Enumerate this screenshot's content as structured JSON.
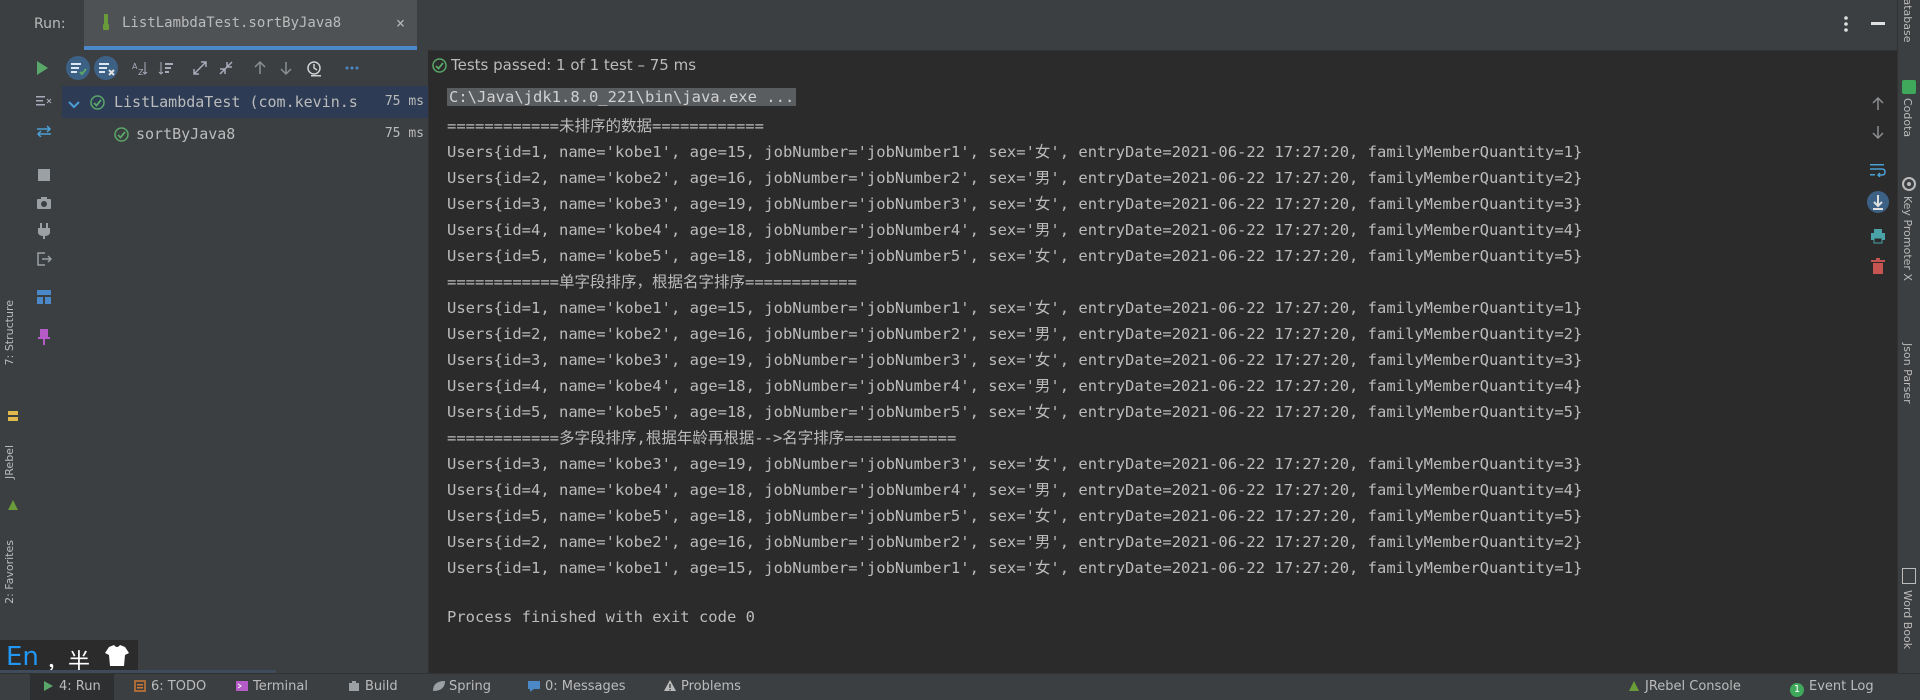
{
  "header": {
    "run_label": "Run:",
    "tab_title": "ListLambdaTest.sortByJava8",
    "close_glyph": "×"
  },
  "toolbar": {
    "status_text": "Tests passed: 1 of 1 test – 75 ms",
    "status_color": "#59a869"
  },
  "test_tree": {
    "root": {
      "name": "ListLambdaTest (com.kevin.s",
      "time": "75 ms"
    },
    "child": {
      "name": "sortByJava8",
      "time": "75 ms"
    }
  },
  "console": {
    "lines": [
      "C:\\Java\\jdk1.8.0_221\\bin\\java.exe ...",
      "============未排序的数据============",
      "Users{id=1, name='kobe1', age=15, jobNumber='jobNumber1', sex='女', entryDate=2021-06-22 17:27:20, familyMemberQuantity=1}",
      "Users{id=2, name='kobe2', age=16, jobNumber='jobNumber2', sex='男', entryDate=2021-06-22 17:27:20, familyMemberQuantity=2}",
      "Users{id=3, name='kobe3', age=19, jobNumber='jobNumber3', sex='女', entryDate=2021-06-22 17:27:20, familyMemberQuantity=3}",
      "Users{id=4, name='kobe4', age=18, jobNumber='jobNumber4', sex='男', entryDate=2021-06-22 17:27:20, familyMemberQuantity=4}",
      "Users{id=5, name='kobe5', age=18, jobNumber='jobNumber5', sex='女', entryDate=2021-06-22 17:27:20, familyMemberQuantity=5}",
      "============单字段排序，根据名字排序============",
      "Users{id=1, name='kobe1', age=15, jobNumber='jobNumber1', sex='女', entryDate=2021-06-22 17:27:20, familyMemberQuantity=1}",
      "Users{id=2, name='kobe2', age=16, jobNumber='jobNumber2', sex='男', entryDate=2021-06-22 17:27:20, familyMemberQuantity=2}",
      "Users{id=3, name='kobe3', age=19, jobNumber='jobNumber3', sex='女', entryDate=2021-06-22 17:27:20, familyMemberQuantity=3}",
      "Users{id=4, name='kobe4', age=18, jobNumber='jobNumber4', sex='男', entryDate=2021-06-22 17:27:20, familyMemberQuantity=4}",
      "Users{id=5, name='kobe5', age=18, jobNumber='jobNumber5', sex='女', entryDate=2021-06-22 17:27:20, familyMemberQuantity=5}",
      "============多字段排序,根据年龄再根据-->名字排序============",
      "Users{id=3, name='kobe3', age=19, jobNumber='jobNumber3', sex='女', entryDate=2021-06-22 17:27:20, familyMemberQuantity=3}",
      "Users{id=4, name='kobe4', age=18, jobNumber='jobNumber4', sex='男', entryDate=2021-06-22 17:27:20, familyMemberQuantity=4}",
      "Users{id=5, name='kobe5', age=18, jobNumber='jobNumber5', sex='女', entryDate=2021-06-22 17:27:20, familyMemberQuantity=5}",
      "Users{id=2, name='kobe2', age=16, jobNumber='jobNumber2', sex='男', entryDate=2021-06-22 17:27:20, familyMemberQuantity=2}",
      "Users{id=1, name='kobe1', age=15, jobNumber='jobNumber1', sex='女', entryDate=2021-06-22 17:27:20, familyMemberQuantity=1}",
      "",
      "Process finished with exit code 0"
    ]
  },
  "left_strip": {
    "structure": "7: Structure",
    "jrebel": "JRebel",
    "favorites": "2: Favorites"
  },
  "right_strip": {
    "database": "Database",
    "codota": "Codota",
    "key_promoter": "Key Promoter X",
    "json_parser": "Json Parser",
    "word_book": "Word Book"
  },
  "bottom_bar": {
    "run": "4: Run",
    "todo": "6: TODO",
    "terminal": "Terminal",
    "build": "Build",
    "spring": "Spring",
    "messages": "0: Messages",
    "problems": "Problems",
    "jrebel_console": "JRebel Console",
    "event_log": "Event Log",
    "event_count": "1"
  },
  "ime": {
    "lang": "En",
    "text": "，半"
  },
  "colors": {
    "accent": "#4a88c7",
    "success": "#59a869",
    "danger": "#c75450"
  }
}
